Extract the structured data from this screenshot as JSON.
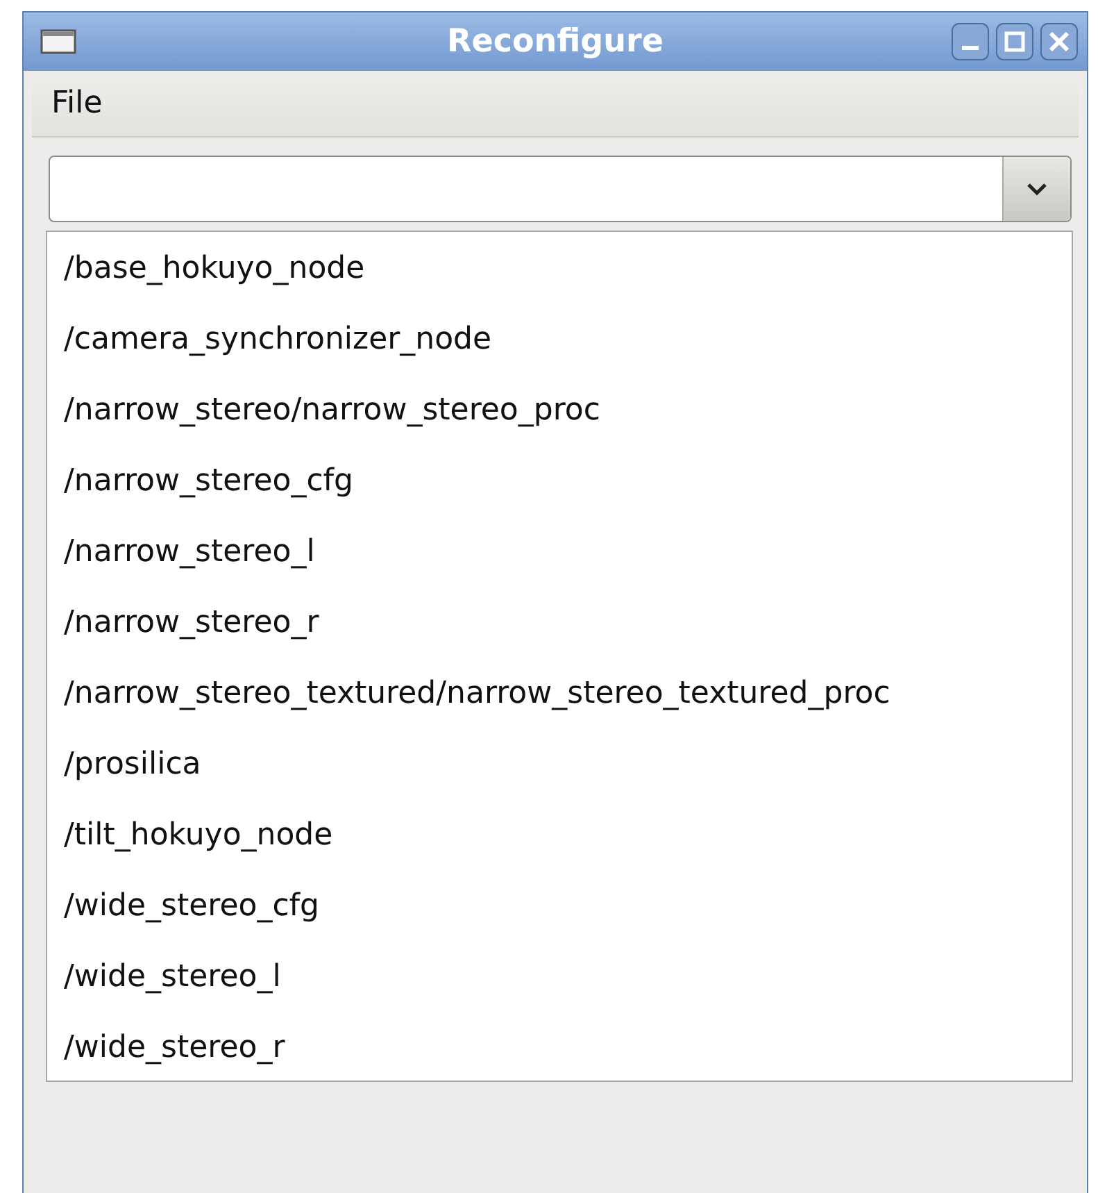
{
  "window": {
    "title": "Reconfigure"
  },
  "menu": [
    {
      "label": "File"
    }
  ],
  "list": [
    "/base_hokuyo_node",
    "/camera_synchronizer_node",
    "/narrow_stereo/narrow_stereo_proc",
    "/narrow_stereo_cfg",
    "/narrow_stereo_l",
    "/narrow_stereo_r",
    "/narrow_stereo_textured/narrow_stereo_textured_proc",
    "/prosilica",
    "/tilt_hokuyo_node",
    "/wide_stereo_cfg",
    "/wide_stereo_l",
    "/wide_stereo_r"
  ]
}
